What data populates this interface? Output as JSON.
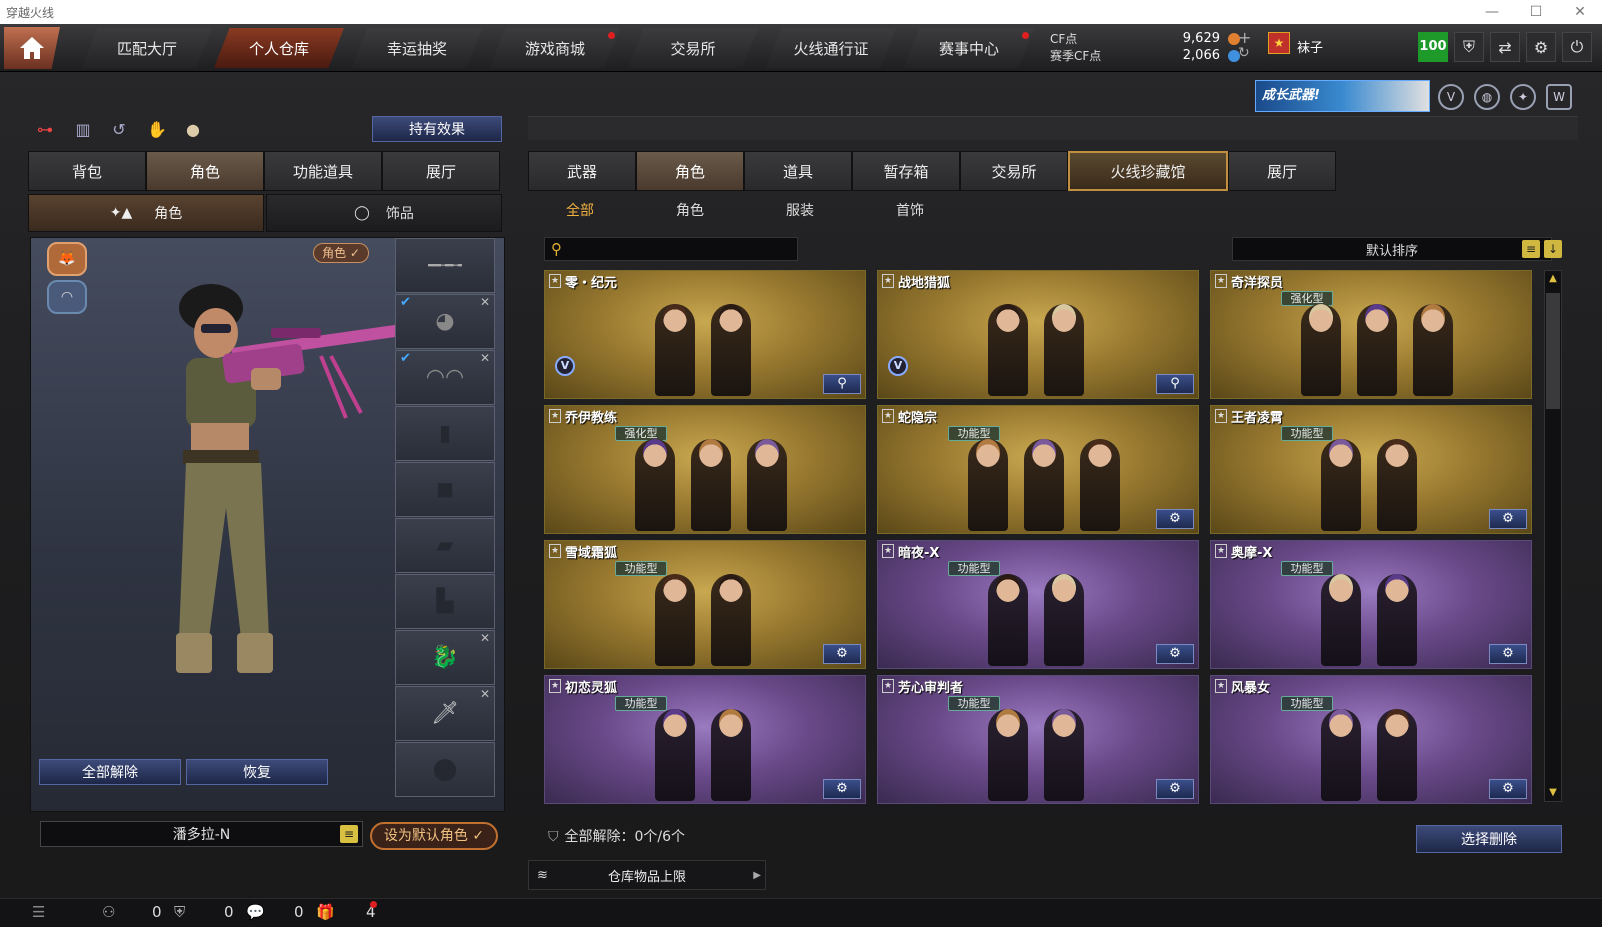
{
  "window": {
    "title": "穿越火线"
  },
  "nav": {
    "tabs": [
      {
        "label": "匹配大厅"
      },
      {
        "label": "个人仓库",
        "active": true
      },
      {
        "label": "幸运抽奖"
      },
      {
        "label": "游戏商城",
        "dot": true
      },
      {
        "label": "交易所"
      },
      {
        "label": "火线通行证"
      },
      {
        "label": "赛事中心",
        "dot": true
      }
    ],
    "cf_label": "CF点",
    "cf_value": "9,629",
    "season_label": "赛季CF点",
    "season_value": "2,066",
    "username": "袜子",
    "level": "100"
  },
  "promo": {
    "text": "成长武器!"
  },
  "left": {
    "effect_button": "持有效果",
    "tabs": [
      "背包",
      "角色",
      "功能道具",
      "展厅"
    ],
    "active_tab": 1,
    "subtabs": [
      "角色",
      "饰品"
    ],
    "role_pill": "角色 ✓",
    "unequip_all": "全部解除",
    "restore": "恢复",
    "character_name": "潘多拉-N",
    "set_default": "设为默认角色 ✓"
  },
  "right": {
    "tabs": [
      "武器",
      "角色",
      "道具",
      "暂存箱",
      "交易所",
      "火线珍藏馆",
      "展厅"
    ],
    "active_tab": 1,
    "highlight_tab": 5,
    "subtabs": [
      "全部",
      "角色",
      "服装",
      "首饰"
    ],
    "sort_label": "默认排序",
    "cards": [
      {
        "title": "零・纪元",
        "badge": "",
        "theme": "gold",
        "figs": 2,
        "v": true,
        "btn": "search"
      },
      {
        "title": "战地猎狐",
        "badge": "",
        "theme": "gold",
        "figs": 2,
        "v": true,
        "btn": "search"
      },
      {
        "title": "奇洋探员",
        "badge": "强化型",
        "theme": "gold",
        "figs": 3,
        "v": false,
        "btn": ""
      },
      {
        "title": "乔伊教练",
        "badge": "强化型",
        "theme": "gold",
        "figs": 3,
        "v": false,
        "btn": ""
      },
      {
        "title": "蛇隐宗",
        "badge": "功能型",
        "theme": "gold",
        "figs": 3,
        "v": false,
        "btn": "gear"
      },
      {
        "title": "王者凌霄",
        "badge": "功能型",
        "theme": "gold",
        "figs": 2,
        "v": false,
        "btn": "gear"
      },
      {
        "title": "雪域霜狐",
        "badge": "功能型",
        "theme": "gold",
        "figs": 2,
        "v": false,
        "btn": "gear"
      },
      {
        "title": "暗夜-X",
        "badge": "功能型",
        "theme": "purple",
        "figs": 2,
        "v": false,
        "btn": "gear"
      },
      {
        "title": "奥摩-X",
        "badge": "功能型",
        "theme": "purple",
        "figs": 2,
        "v": false,
        "btn": "gear"
      },
      {
        "title": "初恋灵狐",
        "badge": "功能型",
        "theme": "purple",
        "figs": 2,
        "v": false,
        "btn": "gear"
      },
      {
        "title": "芳心审判者",
        "badge": "功能型",
        "theme": "purple",
        "figs": 2,
        "v": false,
        "btn": "gear"
      },
      {
        "title": "风暴女",
        "badge": "功能型",
        "theme": "purple",
        "figs": 2,
        "v": false,
        "btn": "gear"
      }
    ],
    "unequip_info": "全部解除：0个/6个",
    "delete_button": "选择删除",
    "capacity_label": "仓库物品上限"
  },
  "status": {
    "count1": "0",
    "count2": "0",
    "count3": "0",
    "count4": "4"
  }
}
